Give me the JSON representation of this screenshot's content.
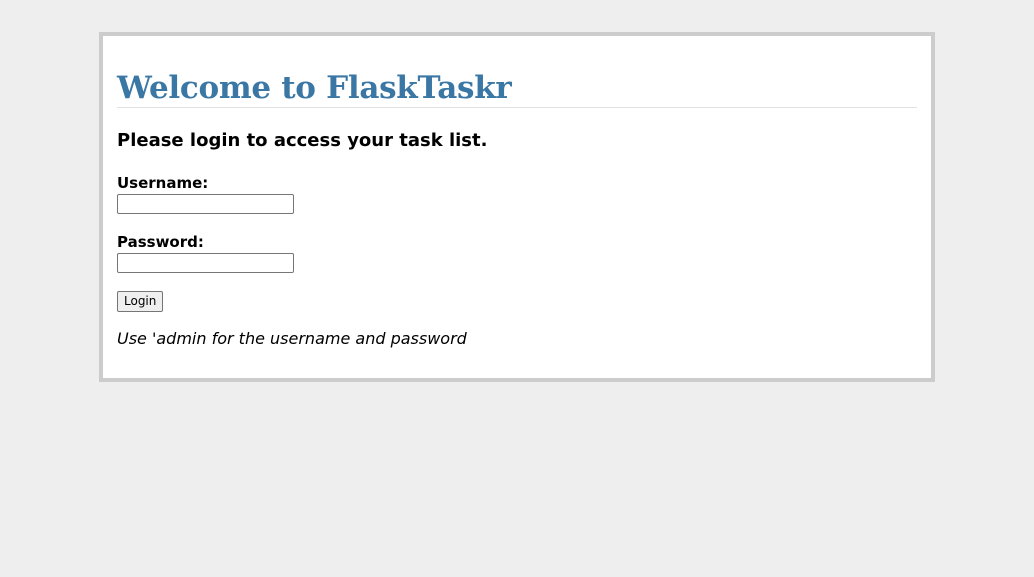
{
  "page": {
    "title": "Welcome to FlaskTaskr",
    "subtitle": "Please login to access your task list."
  },
  "form": {
    "username_label": "Username:",
    "username_value": "",
    "password_label": "Password:",
    "password_value": "",
    "login_label": "Login"
  },
  "hint": "Use 'admin for the username and password",
  "colors": {
    "background": "#eeeeee",
    "panel_border": "#cccccc",
    "title": "#3a77a4"
  }
}
